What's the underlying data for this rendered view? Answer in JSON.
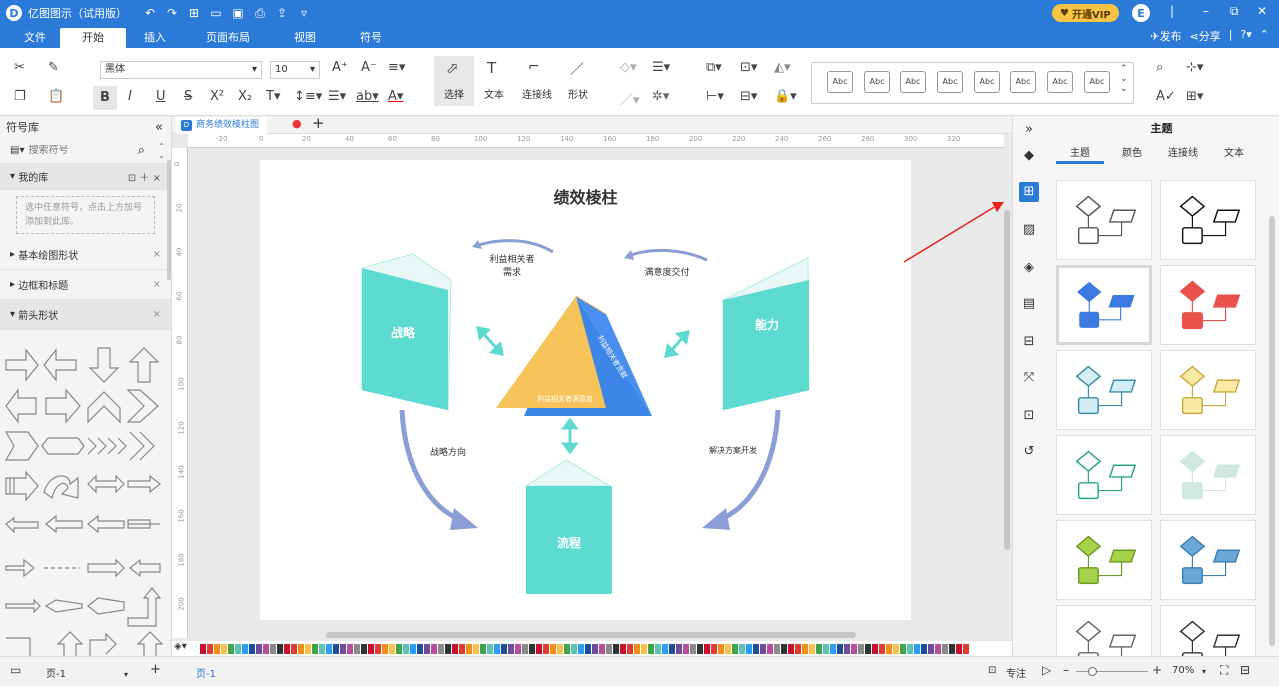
{
  "app": {
    "title": "亿图图示（试用版）",
    "vip_label": "开通VIP",
    "avatar_letter": "E"
  },
  "menu": {
    "items": [
      "文件",
      "开始",
      "插入",
      "页面布局",
      "视图",
      "符号"
    ],
    "active": "开始",
    "publish": "发布",
    "share": "分享"
  },
  "ribbon": {
    "font_name": "黑体",
    "font_size": "10",
    "tools": [
      {
        "label": "选择"
      },
      {
        "label": "文本"
      },
      {
        "label": "连接线"
      },
      {
        "label": "形状"
      }
    ],
    "style_presets": [
      "Abc",
      "Abc",
      "Abc",
      "Abc",
      "Abc",
      "Abc",
      "Abc",
      "Abc"
    ]
  },
  "left_panel": {
    "title": "符号库",
    "search_placeholder": "搜索符号",
    "my_library": "我的库",
    "my_library_hint": "选中任意符号，点击上方加号添加到此库。",
    "sections": [
      "基本绘图形状",
      "边框和标题",
      "箭头形状"
    ]
  },
  "document": {
    "tab_name": "商务绩效棱柱图"
  },
  "ruler": {
    "h_ticks": [
      "-20",
      "0",
      "20",
      "40",
      "60",
      "80",
      "100",
      "120",
      "140",
      "160",
      "180",
      "200",
      "220",
      "240",
      "260",
      "280",
      "300",
      "320"
    ],
    "v_ticks": [
      "0",
      "20",
      "40",
      "60",
      "80",
      "100",
      "120",
      "140",
      "160",
      "180",
      "200"
    ]
  },
  "diagram": {
    "title": "绩效棱柱",
    "strategy": "战略",
    "capability": "能力",
    "process": "流程",
    "label_stakeholder_needs": "利益相关者\n需求",
    "label_satisfaction": "满意度交付",
    "label_strategic_direction": "战略方向",
    "label_solution_dev": "解决方案开发",
    "triangle_bottom": "利益相关者满意度",
    "triangle_side": "利益相关者贡献"
  },
  "right_panel": {
    "title": "主题",
    "tabs": [
      "主题",
      "颜色",
      "连接线",
      "文本"
    ],
    "active_tab": "主题",
    "themes": [
      {
        "fill": "#ffffff",
        "stroke": "#555555"
      },
      {
        "fill": "#ffffff",
        "stroke": "#111111"
      },
      {
        "fill": "#3b7ae0",
        "stroke": "#3b7ae0"
      },
      {
        "fill": "#e8524a",
        "stroke": "#e8524a"
      },
      {
        "fill": "#d4eef6",
        "stroke": "#3a8fa8"
      },
      {
        "fill": "#fbe9a8",
        "stroke": "#c9a93a"
      },
      {
        "fill": "#ffffff",
        "stroke": "#2aa77a"
      },
      {
        "fill": "#cfe9e0",
        "stroke": "#cfe9e0"
      },
      {
        "fill": "#a6d14a",
        "stroke": "#6e9a20"
      },
      {
        "fill": "#6aa8d8",
        "stroke": "#3f7fb2"
      },
      {
        "fill": "#ffffff",
        "stroke": "#666666"
      },
      {
        "fill": "#ffffff",
        "stroke": "#333333"
      }
    ]
  },
  "statusbar": {
    "page_selector": "页-1",
    "page_tab": "页-1",
    "focus": "专注",
    "zoom": "70%"
  },
  "colors": {
    "brand": "#2b7ad8",
    "teal": "#5edbd0",
    "yellow": "#f5c35a",
    "blue": "#3e85e8",
    "arrow": "#8b9fd6",
    "red_annotation": "#e8221b"
  }
}
